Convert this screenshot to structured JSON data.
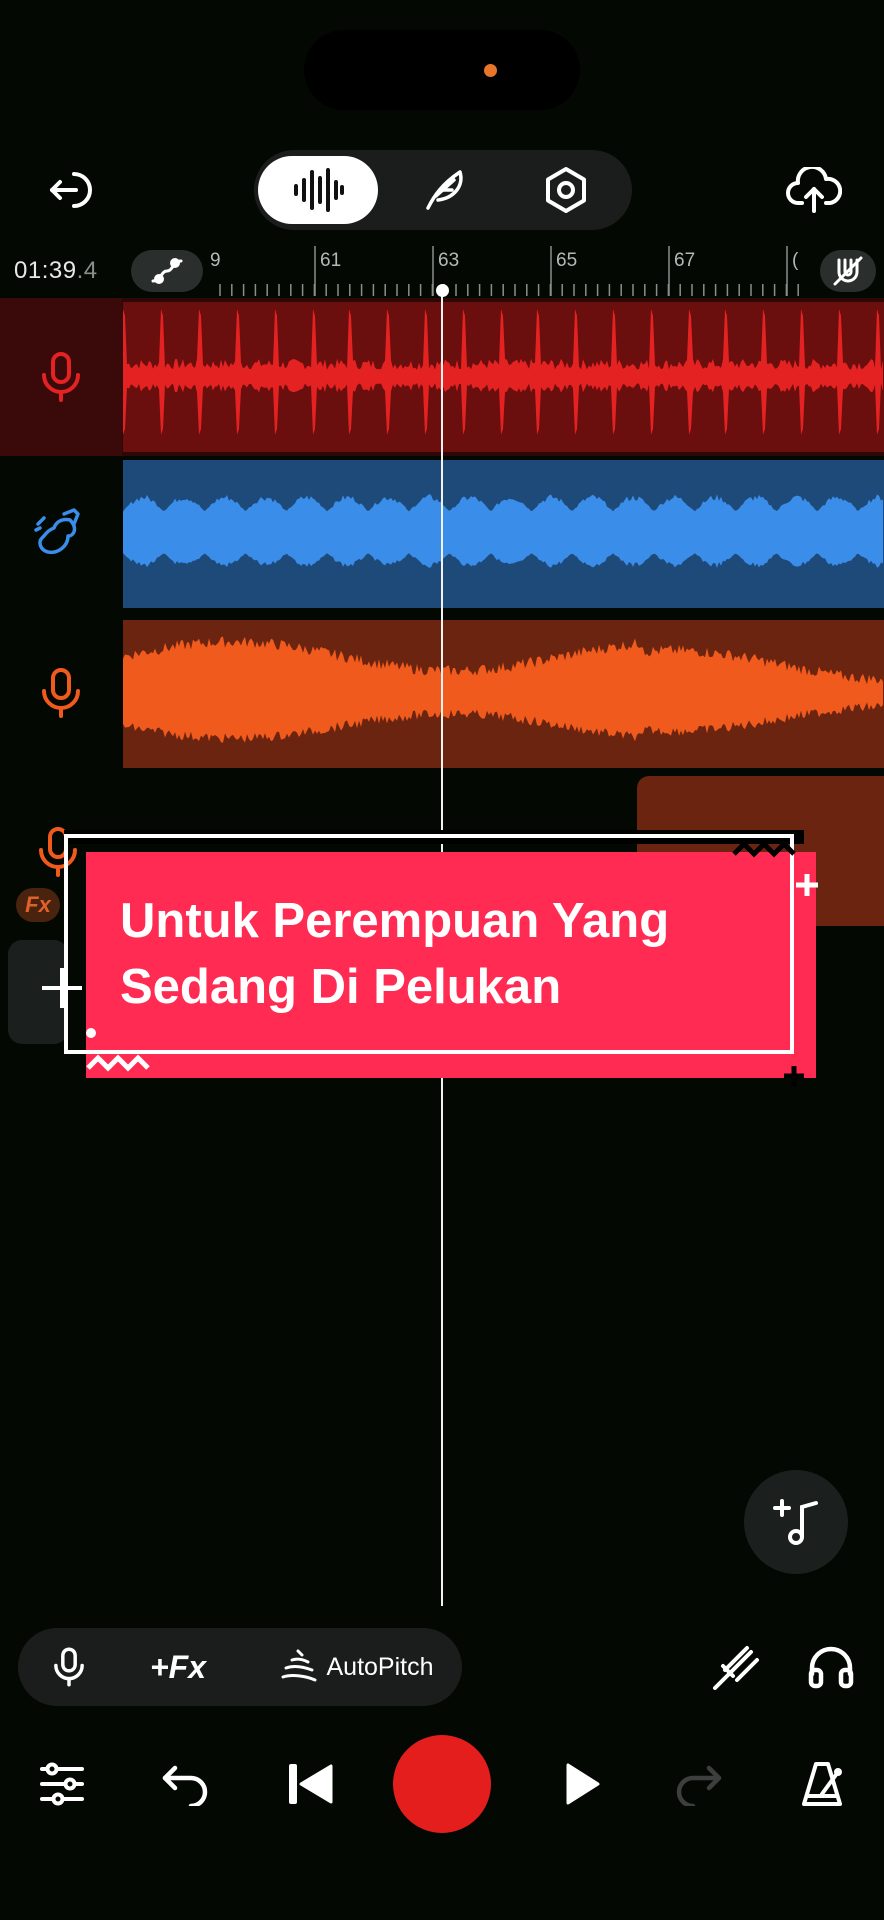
{
  "status": {
    "camera_dot_color": "#e8762a"
  },
  "top_bar": {
    "exit_icon": "exit-icon",
    "modes": [
      "waveform-icon",
      "feather-icon",
      "settings-hex-icon"
    ],
    "active_mode": 0,
    "upload_icon": "cloud-upload-icon"
  },
  "timeline": {
    "time_main": "01:39",
    "time_fraction": ".4",
    "ruler_labels": [
      "9",
      "61",
      "63",
      "65",
      "67",
      "("
    ]
  },
  "tracks": [
    {
      "icon": "microphone-icon",
      "color": "#e52222",
      "bg": "#6a0e0e"
    },
    {
      "icon": "guitar-icon",
      "color": "#3a8de8",
      "bg": "#1e4a7a"
    },
    {
      "icon": "microphone-icon",
      "color": "#f05a1c",
      "bg": "#6b2410"
    },
    {
      "icon": "microphone-icon",
      "color": "#f05a1c",
      "bg": "#6b2410"
    }
  ],
  "overlay": {
    "line1": "Untuk Perempuan Yang",
    "line2": "Sedang Di Pelukan"
  },
  "fx_badge": "Fx",
  "toolbar": {
    "fx_label": "+Fx",
    "autopitch_label": "AutoPitch"
  },
  "colors": {
    "record": "#e41d1d",
    "accent_red": "#ff2b52"
  }
}
